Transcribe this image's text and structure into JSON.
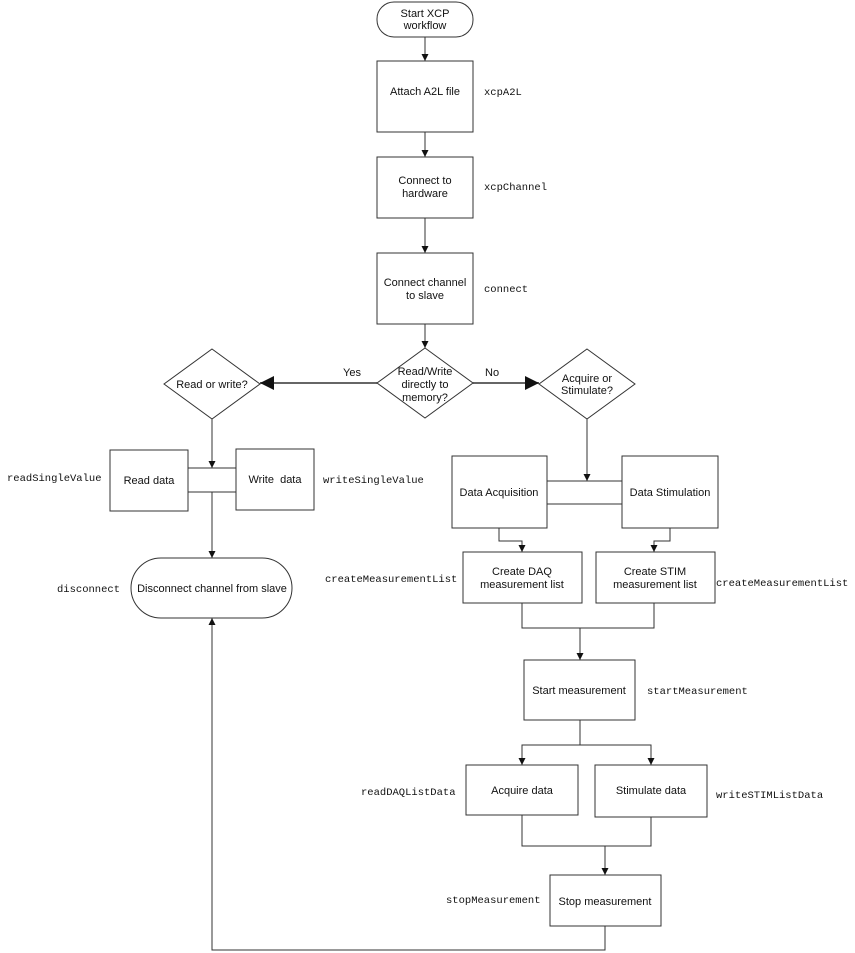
{
  "diagram": {
    "title": "XCP workflow",
    "nodes": {
      "start": {
        "type": "terminator",
        "lines": [
          "Start XCP",
          "workflow"
        ]
      },
      "attach_a2l": {
        "type": "process",
        "lines": [
          "Attach A2L file"
        ],
        "function": "xcpA2L"
      },
      "connect_hw": {
        "type": "process",
        "lines": [
          "Connect to",
          "hardware"
        ],
        "function": "xcpChannel"
      },
      "connect_slave": {
        "type": "process",
        "lines": [
          "Connect channel",
          "to slave"
        ],
        "function": "connect"
      },
      "decision_memory": {
        "type": "decision",
        "lines": [
          "Read/Write",
          "directly to",
          "memory?"
        ]
      },
      "decision_rw": {
        "type": "decision",
        "lines": [
          "Read or write?"
        ]
      },
      "decision_acq": {
        "type": "decision",
        "lines": [
          "Acquire or",
          "Stimulate?"
        ]
      },
      "read_data": {
        "type": "process",
        "lines": [
          "Read data"
        ],
        "function": "readSingleValue"
      },
      "write_data": {
        "type": "process",
        "lines": [
          "Write  data"
        ],
        "function": "writeSingleValue"
      },
      "disconnect": {
        "type": "terminator",
        "lines": [
          "Disconnect channel from slave"
        ],
        "function": "disconnect"
      },
      "data_acq": {
        "type": "process",
        "lines": [
          "Data Acquisition"
        ]
      },
      "data_stim": {
        "type": "process",
        "lines": [
          "Data Stimulation"
        ]
      },
      "create_daq": {
        "type": "process",
        "lines": [
          "Create DAQ",
          "measurement list"
        ],
        "function": "createMeasurementList"
      },
      "create_stim": {
        "type": "process",
        "lines": [
          "Create STIM",
          "measurement list"
        ],
        "function": "createMeasurementList"
      },
      "start_meas": {
        "type": "process",
        "lines": [
          "Start measurement"
        ],
        "function": "startMeasurement"
      },
      "acquire_data": {
        "type": "process",
        "lines": [
          "Acquire data"
        ],
        "function": "readDAQListData"
      },
      "stimulate_data": {
        "type": "process",
        "lines": [
          "Stimulate data"
        ],
        "function": "writeSTIMListData"
      },
      "stop_meas": {
        "type": "process",
        "lines": [
          "Stop measurement"
        ],
        "function": "stopMeasurement"
      }
    },
    "edge_labels": {
      "yes": "Yes",
      "no": "No"
    },
    "edges": [
      {
        "from": "start",
        "to": "attach_a2l"
      },
      {
        "from": "attach_a2l",
        "to": "connect_hw"
      },
      {
        "from": "connect_hw",
        "to": "connect_slave"
      },
      {
        "from": "connect_slave",
        "to": "decision_memory"
      },
      {
        "from": "decision_memory",
        "to": "decision_rw",
        "label": "Yes"
      },
      {
        "from": "decision_memory",
        "to": "decision_acq",
        "label": "No"
      },
      {
        "from": "decision_rw",
        "to": "read_data"
      },
      {
        "from": "decision_rw",
        "to": "write_data"
      },
      {
        "from": "read_data",
        "to": "disconnect"
      },
      {
        "from": "write_data",
        "to": "disconnect"
      },
      {
        "from": "decision_acq",
        "to": "data_acq"
      },
      {
        "from": "decision_acq",
        "to": "data_stim"
      },
      {
        "from": "data_acq",
        "to": "create_daq"
      },
      {
        "from": "data_stim",
        "to": "create_stim"
      },
      {
        "from": "create_daq",
        "to": "start_meas"
      },
      {
        "from": "create_stim",
        "to": "start_meas"
      },
      {
        "from": "start_meas",
        "to": "acquire_data"
      },
      {
        "from": "start_meas",
        "to": "stimulate_data"
      },
      {
        "from": "acquire_data",
        "to": "stop_meas"
      },
      {
        "from": "stimulate_data",
        "to": "stop_meas"
      },
      {
        "from": "stop_meas",
        "to": "disconnect"
      }
    ]
  }
}
